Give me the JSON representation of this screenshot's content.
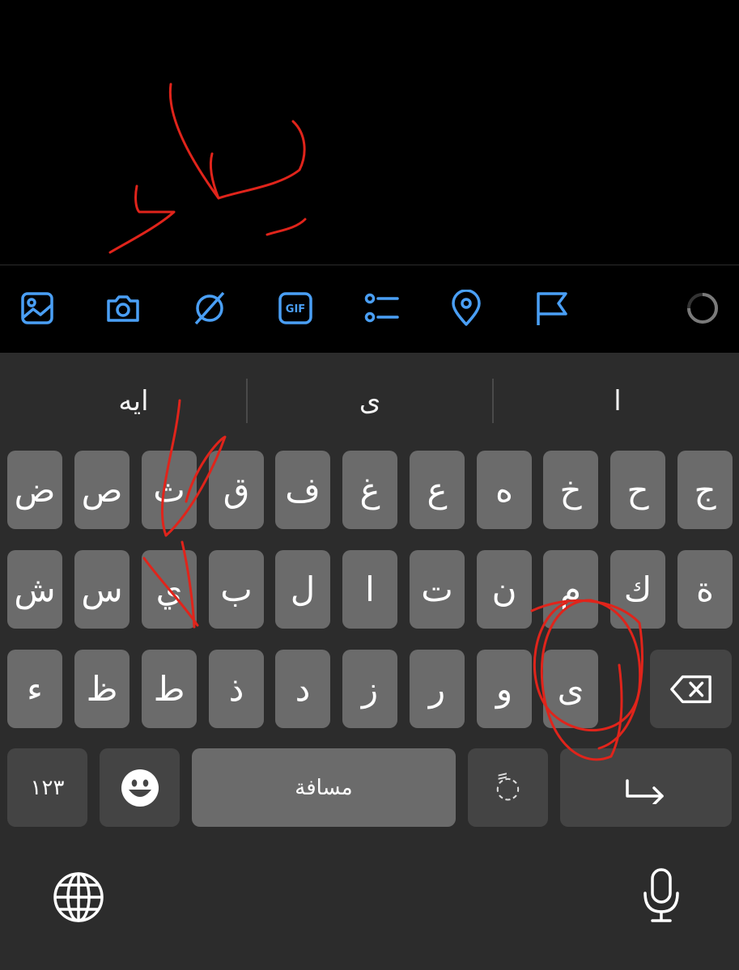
{
  "toolbar": {
    "icons": [
      "image-icon",
      "camera-icon",
      "no-photo-icon",
      "gif-icon",
      "poll-icon",
      "location-pin-icon",
      "flag-icon",
      "progress-ring-icon"
    ],
    "accent_color": "#4a9ff5",
    "gif_label": "GIF"
  },
  "suggestions": [
    "ايه",
    "ى",
    "ا"
  ],
  "keyboard": {
    "row1": [
      "ض",
      "ص",
      "ث",
      "ق",
      "ف",
      "غ",
      "ع",
      "ه",
      "خ",
      "ح",
      "ج"
    ],
    "row2": [
      "ش",
      "س",
      "ي",
      "ب",
      "ل",
      "ا",
      "ت",
      "ن",
      "م",
      "ك",
      "ة"
    ],
    "row3": [
      "ء",
      "ظ",
      "ط",
      "ذ",
      "د",
      "ز",
      "ر",
      "و",
      "ى"
    ],
    "numbers_key": "١٢٣",
    "space_key": "مسافة",
    "tanween_key": "◌ً",
    "icons": [
      "backspace-icon",
      "emoji-icon",
      "enter-arrow-icon",
      "globe-icon",
      "microphone-icon"
    ]
  },
  "colors": {
    "annotation": "#e0241b",
    "key": "#6b6b6b",
    "key_dark": "#444444",
    "keyboard_bg": "#2c2c2c"
  }
}
